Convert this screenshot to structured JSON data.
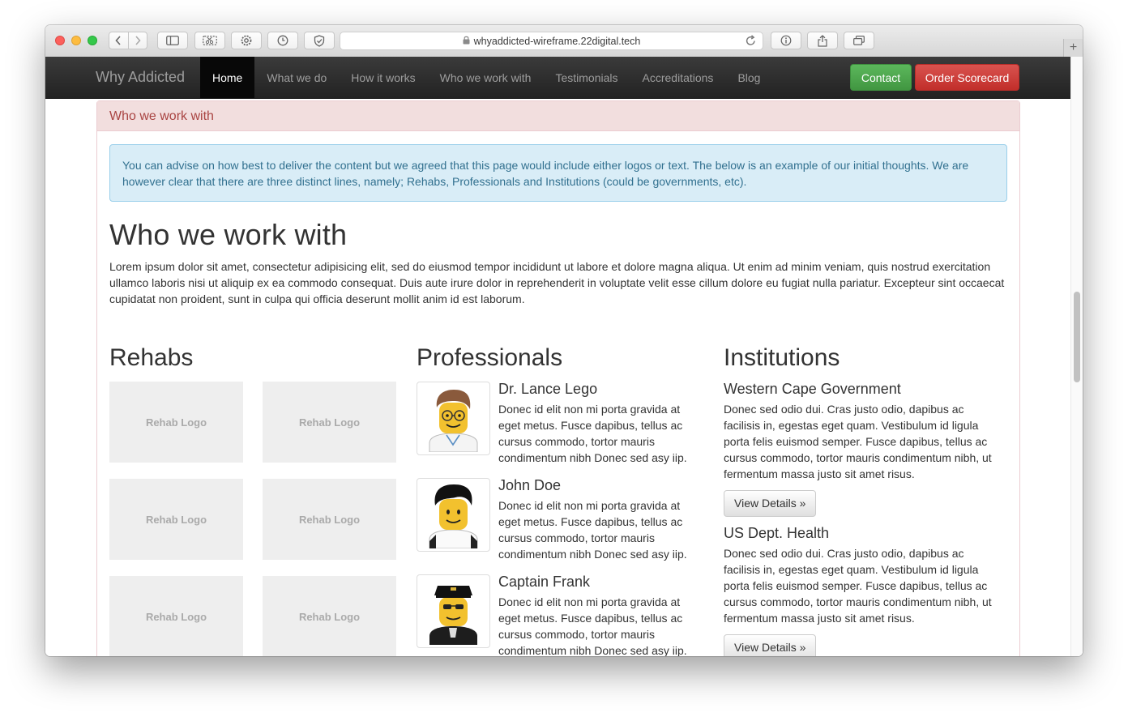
{
  "browser": {
    "url": "whyaddicted-wireframe.22digital.tech",
    "new_tab_label": "+"
  },
  "navbar": {
    "brand": "Why Addicted",
    "links": [
      "Home",
      "What we do",
      "How it works",
      "Who we work with",
      "Testimonials",
      "Accreditations",
      "Blog"
    ],
    "contact_label": "Contact",
    "order_label": "Order Scorecard"
  },
  "panel": {
    "heading": "Who we work with",
    "alert": "You can advise on how best to deliver the content but we agreed that this page would include either logos or text. The below is an example of our initial thoughts. We are however clear that there are three distinct lines, namely; Rehabs, Professionals and Institutions (could be governments, etc).",
    "title": "Who we work with",
    "intro": "Lorem ipsum dolor sit amet, consectetur adipisicing elit, sed do eiusmod tempor incididunt ut labore et dolore magna aliqua. Ut enim ad minim veniam, quis nostrud exercitation ullamco laboris nisi ut aliquip ex ea commodo consequat. Duis aute irure dolor in reprehenderit in voluptate velit esse cillum dolore eu fugiat nulla pariatur. Excepteur sint occaecat cupidatat non proident, sunt in culpa qui officia deserunt mollit anim id est laborum."
  },
  "rehabs": {
    "heading": "Rehabs",
    "logo_label": "Rehab Logo",
    "logos": [
      "Rehab Logo",
      "Rehab Logo",
      "Rehab Logo",
      "Rehab Logo",
      "Rehab Logo",
      "Rehab Logo"
    ]
  },
  "professionals": {
    "heading": "Professionals",
    "people": [
      {
        "name": "Dr. Lance Lego",
        "bio": "Donec id elit non mi porta gravida at eget metus. Fusce dapibus, tellus ac cursus commodo, tortor mauris condimentum nibh Donec sed asy iip."
      },
      {
        "name": "John Doe",
        "bio": "Donec id elit non mi porta gravida at eget metus. Fusce dapibus, tellus ac cursus commodo, tortor mauris condimentum nibh Donec sed asy iip."
      },
      {
        "name": "Captain Frank",
        "bio": "Donec id elit non mi porta gravida at eget metus. Fusce dapibus, tellus ac cursus commodo, tortor mauris condimentum nibh Donec sed asy iip."
      }
    ]
  },
  "institutions": {
    "heading": "Institutions",
    "items": [
      {
        "name": "Western Cape Government",
        "text": "Donec sed odio dui. Cras justo odio, dapibus ac facilisis in, egestas eget quam. Vestibulum id ligula porta felis euismod semper. Fusce dapibus, tellus ac cursus commodo, tortor mauris condimentum nibh, ut fermentum massa justo sit amet risus.",
        "button": "View Details »"
      },
      {
        "name": "US Dept. Health",
        "text": "Donec sed odio dui. Cras justo odio, dapibus ac facilisis in, egestas eget quam. Vestibulum id ligula porta felis euismod semper. Fusce dapibus, tellus ac cursus commodo, tortor mauris condimentum nibh, ut fermentum massa justo sit amet risus.",
        "button": "View Details »"
      }
    ]
  },
  "colors": {
    "navbar_bg": "#222222",
    "contact_green": "#5cb85c",
    "order_red": "#d9534f",
    "panel_heading_bg": "#f2dede",
    "alert_bg": "#d9edf7"
  },
  "icons": [
    "back-icon",
    "forward-icon",
    "sidebar-icon",
    "scissors-icon",
    "gear-icon",
    "history-icon",
    "shield-icon",
    "lock-icon",
    "reload-icon",
    "info-icon",
    "share-icon",
    "tabs-icon"
  ]
}
